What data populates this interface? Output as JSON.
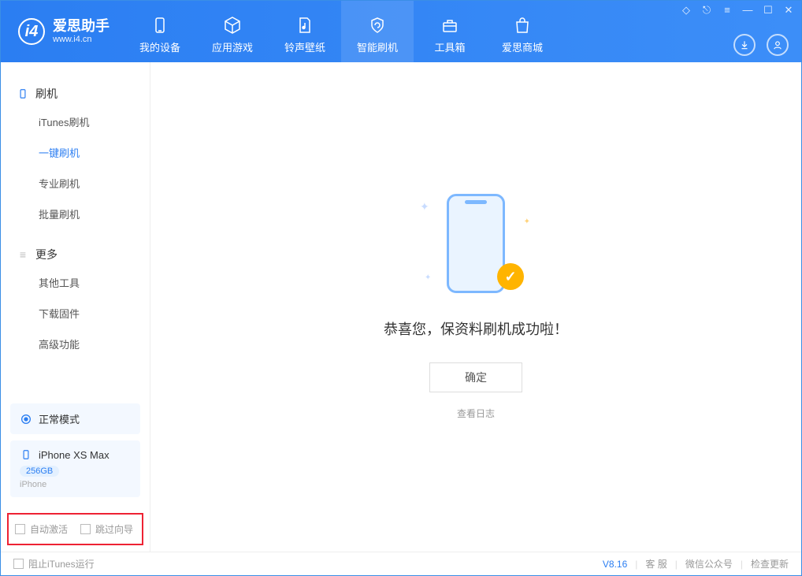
{
  "app": {
    "title": "爱思助手",
    "subtitle": "www.i4.cn"
  },
  "nav": {
    "items": [
      {
        "label": "我的设备"
      },
      {
        "label": "应用游戏"
      },
      {
        "label": "铃声壁纸"
      },
      {
        "label": "智能刷机"
      },
      {
        "label": "工具箱"
      },
      {
        "label": "爱思商城"
      }
    ]
  },
  "sidebar": {
    "group1": {
      "title": "刷机",
      "items": [
        "iTunes刷机",
        "一键刷机",
        "专业刷机",
        "批量刷机"
      ]
    },
    "group2": {
      "title": "更多",
      "items": [
        "其他工具",
        "下载固件",
        "高级功能"
      ]
    },
    "mode": {
      "label": "正常模式"
    },
    "device": {
      "name": "iPhone XS Max",
      "storage": "256GB",
      "type": "iPhone"
    },
    "opts": {
      "auto_activate": "自动激活",
      "skip_guide": "跳过向导"
    }
  },
  "main": {
    "message": "恭喜您，保资料刷机成功啦！",
    "ok": "确定",
    "view_log": "查看日志"
  },
  "footer": {
    "block_itunes": "阻止iTunes运行",
    "version": "V8.16",
    "support": "客 服",
    "wechat": "微信公众号",
    "update": "检查更新"
  }
}
